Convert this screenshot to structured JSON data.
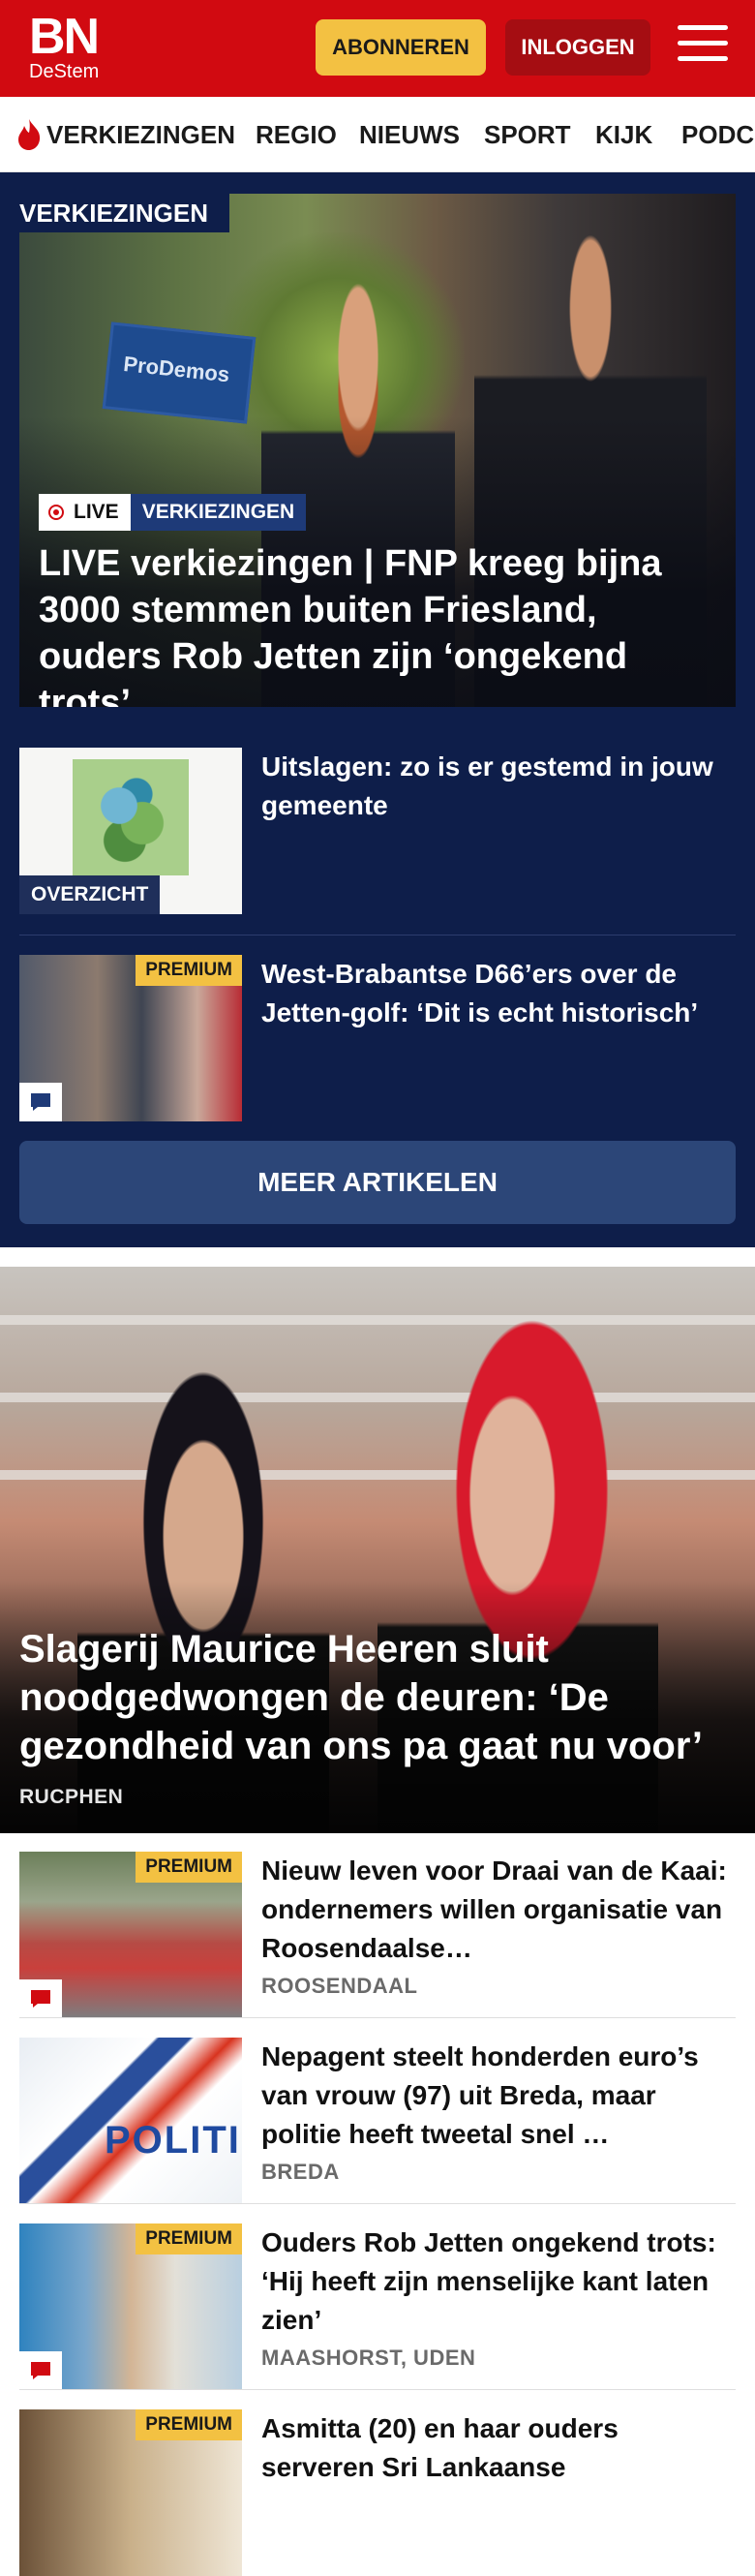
{
  "header": {
    "logo_main": "BN",
    "logo_sub": "DeStem",
    "subscribe_label": "ABONNEREN",
    "login_label": "INLOGGEN"
  },
  "nav": {
    "items": [
      "VERKIEZINGEN",
      "REGIO",
      "NIEUWS",
      "SPORT",
      "KIJK",
      "PODC"
    ]
  },
  "election": {
    "section_label": "VERKIEZINGEN",
    "live_label": "LIVE",
    "topic_label": "VERKIEZINGEN",
    "hero_title": "LIVE verkiezingen | FNP kreeg bijna 3000 stemmen buiten Friesland, ouders Rob Jetten zijn ‘ongekend trots’",
    "hero_sign_text": "ProDemos",
    "articles": [
      {
        "title": "Uitslagen: zo is er gestemd in jouw gemeente",
        "badge": "OVERZICHT"
      },
      {
        "title": "West-Brabantse D66’ers over de Jetten-golf: ‘Dit is echt historisch’",
        "badge": "PREMIUM"
      }
    ],
    "more_label": "MEER ARTIKELEN"
  },
  "feature": {
    "title": "Slagerij Maurice Heeren sluit noodgedwongen de deuren: ‘De gezondheid van ons pa gaat nu voor’",
    "location": "RUCPHEN"
  },
  "list": [
    {
      "title": "Nieuw leven voor Draai van de Kaai: ondernemers willen organisatie van Roosendaalse…",
      "location": "ROOSENDAAL",
      "premium": "PREMIUM"
    },
    {
      "title": "Nepagent steelt honderden euro’s van vrouw (97) uit Breda, maar politie heeft tweetal snel …",
      "location": "BREDA",
      "thumb_text": "POLITIE"
    },
    {
      "title": "Ouders Rob Jetten ongekend trots: ‘Hij heeft zijn menselijke kant laten zien’",
      "location": "MAASHORST, UDEN",
      "premium": "PREMIUM"
    },
    {
      "title": "Asmitta (20) en haar ouders serveren Sri Lankaanse",
      "location": "",
      "premium": "PREMIUM"
    }
  ],
  "colors": {
    "brand_red": "#d10a11",
    "subscribe_yellow": "#f3c142",
    "navy": "#0e1e4a",
    "more_button": "#2c4678"
  }
}
